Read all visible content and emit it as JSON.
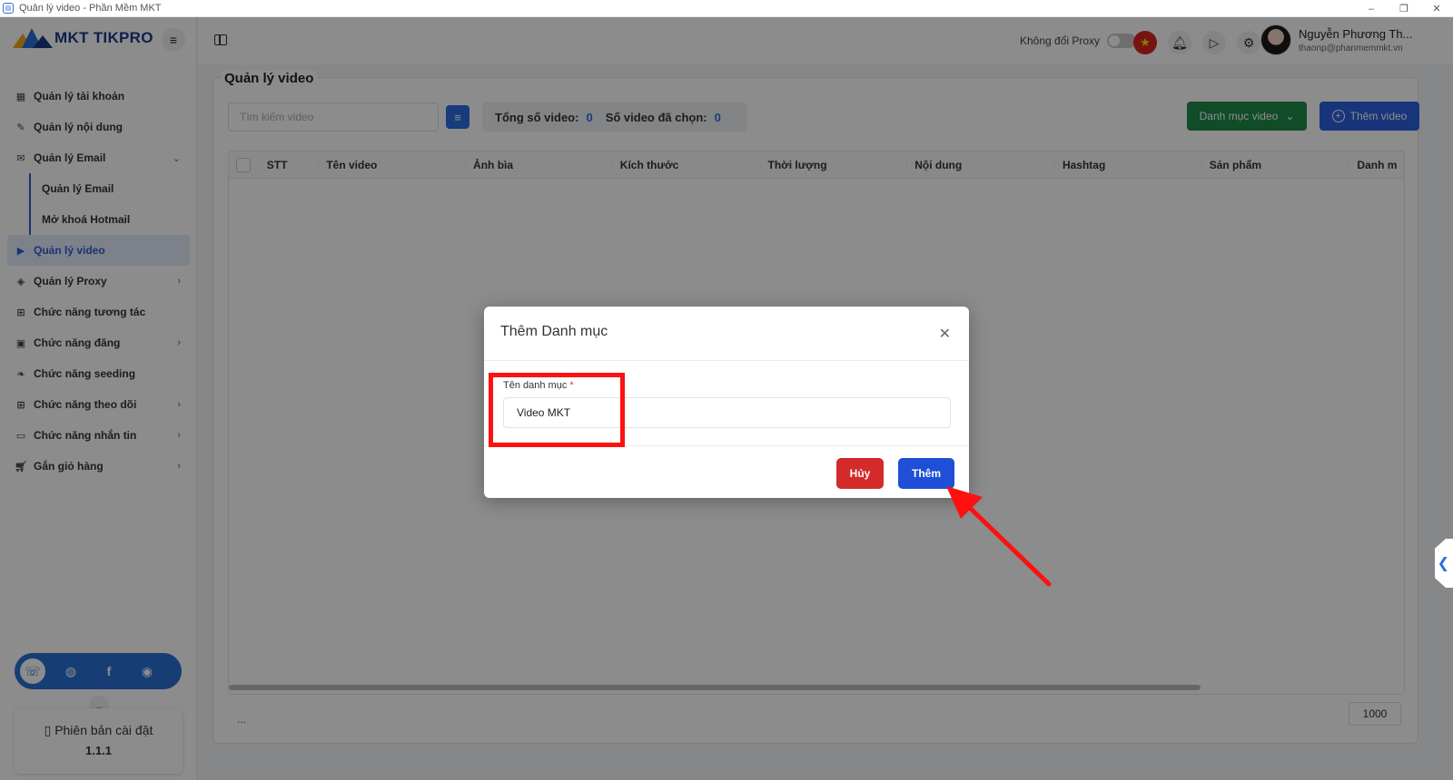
{
  "window": {
    "title": "Quản lý video - Phần Mềm MKT",
    "controls": [
      "–",
      "❐",
      "✕"
    ]
  },
  "brand": {
    "name": "MKT TIKPRO",
    "colors": [
      "#f2a818",
      "#2a6fd6",
      "#1d3a8a"
    ]
  },
  "sidebar": {
    "items": [
      {
        "label": "Quản lý tài khoản",
        "icon": "grid-icon"
      },
      {
        "label": "Quản lý nội dung",
        "icon": "edit-icon"
      },
      {
        "label": "Quản lý Email",
        "icon": "mail-icon",
        "chevron": "⌄"
      },
      {
        "label": "Quản lý Email",
        "sub": true
      },
      {
        "label": "Mở khoá Hotmail",
        "sub": true
      },
      {
        "label": "Quản lý video",
        "icon": "video-icon",
        "active": true
      },
      {
        "label": "Quản lý Proxy",
        "icon": "layers-icon",
        "chevron": "›"
      },
      {
        "label": "Chức năng tương tác",
        "icon": "interaction-icon"
      },
      {
        "label": "Chức năng đăng",
        "icon": "post-icon",
        "chevron": "›"
      },
      {
        "label": "Chức năng seeding",
        "icon": "seeding-icon"
      },
      {
        "label": "Chức năng theo dõi",
        "icon": "follow-icon",
        "chevron": "›"
      },
      {
        "label": "Chức năng nhắn tin",
        "icon": "message-icon",
        "chevron": "›"
      },
      {
        "label": "Gắn giỏ hàng",
        "icon": "cart-icon",
        "chevron": "›"
      }
    ],
    "version_label": "Phiên bản cài đặt",
    "version": "1.1.1"
  },
  "header": {
    "proxy_label": "Không đổi Proxy",
    "user_name": "Nguyễn Phương Th...",
    "user_email": "thaonp@phanmemmkt.vn"
  },
  "main": {
    "title": "Quản lý video",
    "search_placeholder": "Tìm kiếm video",
    "total_label": "Tổng số video:",
    "total_value": "0",
    "selected_label": "Số video đã chọn:",
    "selected_value": "0",
    "category_button": "Danh mục video",
    "add_button": "Thêm video",
    "columns": [
      "STT",
      "Tên video",
      "Ảnh bìa",
      "Kích thước",
      "Thời lượng",
      "Nội dung",
      "Hashtag",
      "Sản phẩm",
      "Danh m"
    ],
    "footer_text": "...",
    "page_size": "1000"
  },
  "modal": {
    "title": "Thêm Danh mục",
    "field_label": "Tên danh mục",
    "required_mark": "*",
    "field_value": "Video MKT",
    "cancel_label": "Hủy",
    "submit_label": "Thêm"
  },
  "colors": {
    "accent": "#2d6ee0",
    "highlight": "#ff1010",
    "cancel": "#d42a2a",
    "submit": "#1f4fd6",
    "category": "#1f8a4c"
  }
}
